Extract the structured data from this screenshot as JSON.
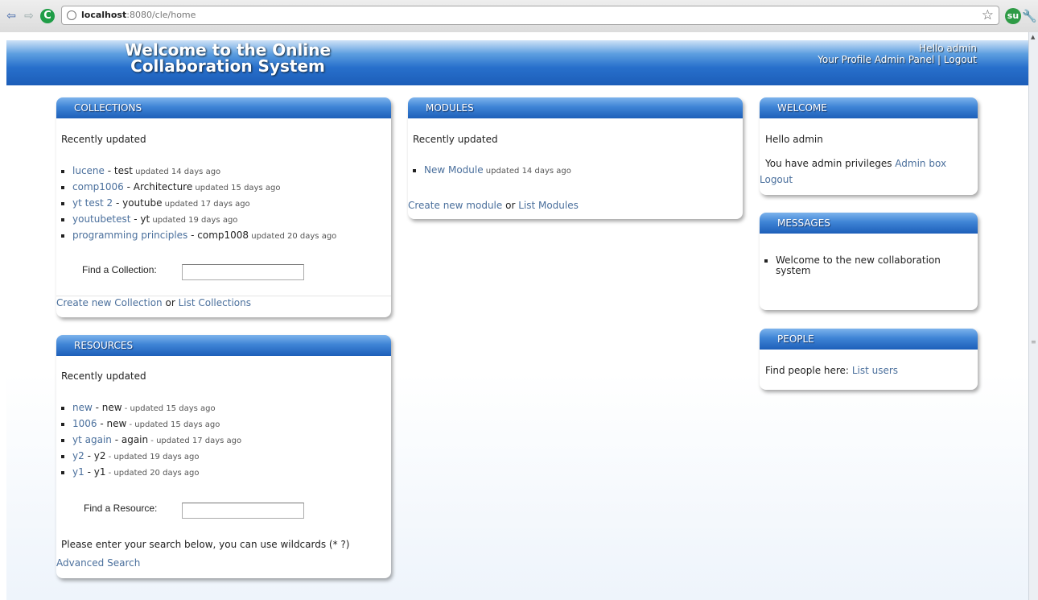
{
  "browser": {
    "url_host": "localhost",
    "url_rest": ":8080/cle/home"
  },
  "header": {
    "title": "Welcome to the Online Collaboration System",
    "hello": "Hello admin",
    "profile": "Your Profile",
    "admin_panel": "Admin Panel",
    "separator": "|",
    "logout": "Logout"
  },
  "collections": {
    "title": "COLLECTIONS",
    "subtitle": "Recently updated",
    "items": [
      {
        "name": "lucene",
        "sep": " - ",
        "desc": "test",
        "updated": " updated 14 days ago"
      },
      {
        "name": "comp1006",
        "sep": " - ",
        "desc": "Architecture",
        "updated": " updated 15 days ago"
      },
      {
        "name": "yt test 2",
        "sep": " - ",
        "desc": "youtube",
        "updated": " updated 17 days ago"
      },
      {
        "name": "youtubetest",
        "sep": " - ",
        "desc": "yt",
        "updated": " updated 19 days ago"
      },
      {
        "name": "programming principles",
        "sep": " - ",
        "desc": "comp1008",
        "updated": " updated 20 days ago"
      }
    ],
    "find_label": "Find a Collection:",
    "find_value": "",
    "create_link": "Create new Collection",
    "or": " or ",
    "list_link": "List Collections"
  },
  "modules": {
    "title": "MODULES",
    "subtitle": "Recently updated",
    "items": [
      {
        "name": "New Module",
        "updated": " updated 14 days ago"
      }
    ],
    "create_link": "Create new module",
    "or": " or ",
    "list_link": "List Modules"
  },
  "resources": {
    "title": "RESOURCES",
    "subtitle": "Recently updated",
    "items": [
      {
        "name": "new",
        "sep": " - ",
        "desc": "new",
        "updated": " - updated 15 days ago"
      },
      {
        "name": "1006",
        "sep": " - ",
        "desc": "new",
        "updated": " - updated 15 days ago"
      },
      {
        "name": "yt again",
        "sep": " - ",
        "desc": "again",
        "updated": " - updated 17 days ago"
      },
      {
        "name": "y2",
        "sep": " - ",
        "desc": "y2",
        "updated": " - updated 19 days ago"
      },
      {
        "name": "y1",
        "sep": " - ",
        "desc": "y1",
        "updated": " - updated 20 days ago"
      }
    ],
    "find_label": "Find a Resource:",
    "find_value": "",
    "search_hint": "Please enter your search below, you can use wildcards (* ?)",
    "advanced_link": "Advanced Search"
  },
  "welcome": {
    "title": "WELCOME",
    "hello": "Hello admin",
    "privileges": "You have admin privileges",
    "admin_box": "Admin box",
    "logout": "Logout"
  },
  "messages": {
    "title": "MESSAGES",
    "items": [
      "Welcome to the new collaboration system"
    ]
  },
  "people": {
    "title": "PEOPLE",
    "text": "Find people here:",
    "list_link": "List users"
  }
}
